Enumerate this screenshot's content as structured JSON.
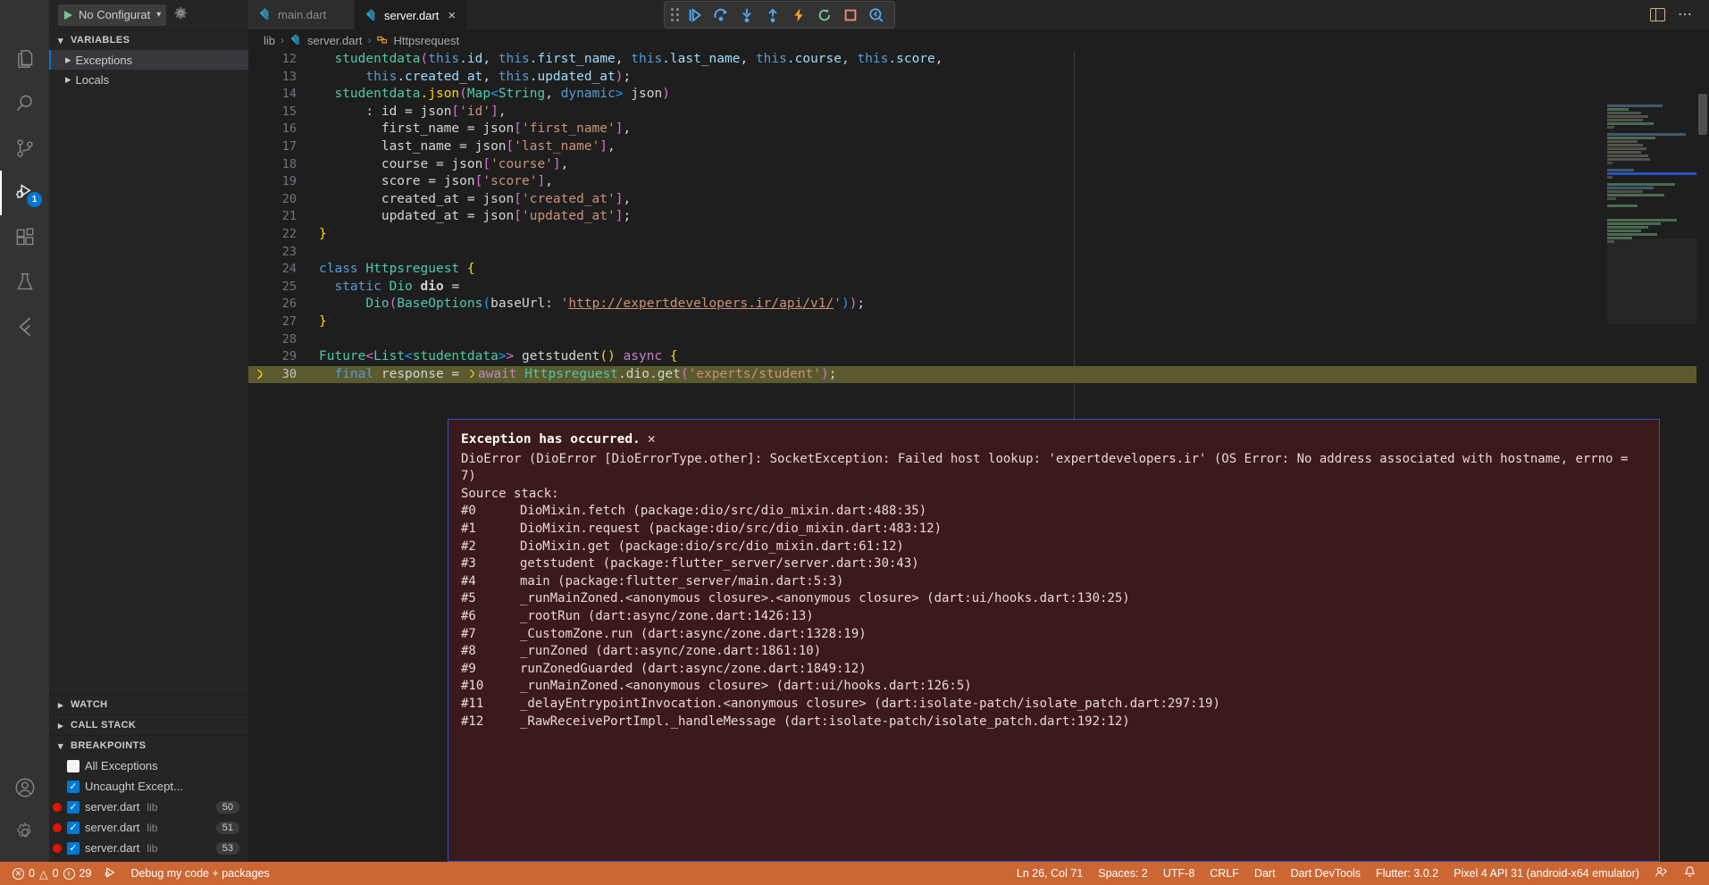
{
  "titlebar": {
    "run_config_label": "No Configurat",
    "run_config_full": "No Configurations",
    "gear_icon": "gear-icon",
    "play_icon": "play-icon",
    "chevron_icon": "chevron-down-icon",
    "layout_icon": "toggle-panel-icon",
    "more_icon": "more-actions-icon"
  },
  "tabs": [
    {
      "label": "main.dart",
      "active": false,
      "icon": "dart-file-icon"
    },
    {
      "label": "server.dart",
      "active": true,
      "icon": "dart-file-icon"
    }
  ],
  "debug_toolbar": {
    "buttons": [
      {
        "name": "drag-handle",
        "title": "Drag"
      },
      {
        "name": "continue-button",
        "title": "Continue"
      },
      {
        "name": "step-over-button",
        "title": "Step Over"
      },
      {
        "name": "step-into-button",
        "title": "Step Into"
      },
      {
        "name": "step-out-button",
        "title": "Step Out"
      },
      {
        "name": "hot-reload-button",
        "title": "Hot Reload"
      },
      {
        "name": "restart-button",
        "title": "Hot Restart"
      },
      {
        "name": "stop-button",
        "title": "Stop"
      },
      {
        "name": "inspect-widget-button",
        "title": "Inspect Widget"
      }
    ]
  },
  "activitybar": {
    "items": [
      {
        "name": "explorer",
        "icon": "files-icon",
        "active": false
      },
      {
        "name": "search",
        "icon": "search-icon",
        "active": false
      },
      {
        "name": "source-control",
        "icon": "source-control-icon",
        "active": false
      },
      {
        "name": "run-and-debug",
        "icon": "debug-icon",
        "active": true,
        "badge": "1"
      },
      {
        "name": "extensions",
        "icon": "extensions-icon",
        "active": false
      },
      {
        "name": "testing",
        "icon": "beaker-icon",
        "active": false
      },
      {
        "name": "flutter",
        "icon": "flutter-icon",
        "active": false
      }
    ],
    "bottom": [
      {
        "name": "accounts",
        "icon": "account-icon"
      },
      {
        "name": "settings",
        "icon": "gear-icon"
      }
    ]
  },
  "sidebar": {
    "variables": {
      "title": "VARIABLES",
      "expanded": true,
      "rows": [
        {
          "label": "Exceptions",
          "selected": true
        },
        {
          "label": "Locals",
          "selected": false
        }
      ]
    },
    "watch": {
      "title": "WATCH",
      "expanded": false
    },
    "callstack": {
      "title": "CALL STACK",
      "expanded": false
    },
    "breakpoints": {
      "title": "BREAKPOINTS",
      "expanded": true,
      "rows": [
        {
          "label": "All Exceptions",
          "checked": false,
          "dot": false,
          "lib": "",
          "line": ""
        },
        {
          "label": "Uncaught Except...",
          "checked": true,
          "dot": false,
          "lib": "",
          "line": ""
        },
        {
          "label": "server.dart",
          "checked": true,
          "dot": true,
          "lib": "lib",
          "line": "50"
        },
        {
          "label": "server.dart",
          "checked": true,
          "dot": true,
          "lib": "lib",
          "line": "51"
        },
        {
          "label": "server.dart",
          "checked": true,
          "dot": true,
          "lib": "lib",
          "line": "53"
        }
      ]
    }
  },
  "breadcrumb": {
    "items": [
      "lib",
      "server.dart",
      "Httpsrequest"
    ],
    "separator": "›"
  },
  "editor": {
    "lines": [
      {
        "num": "12",
        "marker": false,
        "highlight": false,
        "tokens": [
          {
            "t": "  ",
            "c": "t-plain"
          },
          {
            "t": "studentdata",
            "c": "t-fn"
          },
          {
            "t": "(",
            "c": "t-p2"
          },
          {
            "t": "this",
            "c": "t-this"
          },
          {
            "t": ".id",
            "c": "t-var"
          },
          {
            "t": ", ",
            "c": "t-plain"
          },
          {
            "t": "this",
            "c": "t-this"
          },
          {
            "t": ".first_name",
            "c": "t-var"
          },
          {
            "t": ", ",
            "c": "t-plain"
          },
          {
            "t": "this",
            "c": "t-this"
          },
          {
            "t": ".last_name",
            "c": "t-var"
          },
          {
            "t": ", ",
            "c": "t-plain"
          },
          {
            "t": "this",
            "c": "t-this"
          },
          {
            "t": ".course",
            "c": "t-var"
          },
          {
            "t": ", ",
            "c": "t-plain"
          },
          {
            "t": "this",
            "c": "t-this"
          },
          {
            "t": ".score",
            "c": "t-var"
          },
          {
            "t": ",",
            "c": "t-plain"
          }
        ]
      },
      {
        "num": "13",
        "marker": false,
        "highlight": false,
        "tokens": [
          {
            "t": "      ",
            "c": "t-plain"
          },
          {
            "t": "this",
            "c": "t-this"
          },
          {
            "t": ".created_at",
            "c": "t-var"
          },
          {
            "t": ", ",
            "c": "t-plain"
          },
          {
            "t": "this",
            "c": "t-this"
          },
          {
            "t": ".updated_at",
            "c": "t-var"
          },
          {
            "t": ")",
            "c": "t-p2"
          },
          {
            "t": ";",
            "c": "t-plain"
          }
        ]
      },
      {
        "num": "14",
        "marker": false,
        "highlight": false,
        "tokens": [
          {
            "t": "  ",
            "c": "t-plain"
          },
          {
            "t": "studentdata",
            "c": "t-fn"
          },
          {
            "t": ".json",
            "c": "t-p1"
          },
          {
            "t": "(",
            "c": "t-p2"
          },
          {
            "t": "Map",
            "c": "t-cls"
          },
          {
            "t": "<",
            "c": "t-p3"
          },
          {
            "t": "String",
            "c": "t-cls"
          },
          {
            "t": ", ",
            "c": "t-plain"
          },
          {
            "t": "dynamic",
            "c": "t-kw"
          },
          {
            "t": ">",
            "c": "t-p3"
          },
          {
            "t": " json",
            "c": "t-plain"
          },
          {
            "t": ")",
            "c": "t-p2"
          }
        ]
      },
      {
        "num": "15",
        "marker": false,
        "highlight": false,
        "tokens": [
          {
            "t": "      : id = ",
            "c": "t-plain"
          },
          {
            "t": "json",
            "c": "t-plain"
          },
          {
            "t": "[",
            "c": "t-p2"
          },
          {
            "t": "'id'",
            "c": "t-str"
          },
          {
            "t": "]",
            "c": "t-p2"
          },
          {
            "t": ",",
            "c": "t-plain"
          }
        ]
      },
      {
        "num": "16",
        "marker": false,
        "highlight": false,
        "tokens": [
          {
            "t": "        first_name = ",
            "c": "t-plain"
          },
          {
            "t": "json",
            "c": "t-plain"
          },
          {
            "t": "[",
            "c": "t-p2"
          },
          {
            "t": "'first_name'",
            "c": "t-str"
          },
          {
            "t": "]",
            "c": "t-p2"
          },
          {
            "t": ",",
            "c": "t-plain"
          }
        ]
      },
      {
        "num": "17",
        "marker": false,
        "highlight": false,
        "tokens": [
          {
            "t": "        last_name = ",
            "c": "t-plain"
          },
          {
            "t": "json",
            "c": "t-plain"
          },
          {
            "t": "[",
            "c": "t-p2"
          },
          {
            "t": "'last_name'",
            "c": "t-str"
          },
          {
            "t": "]",
            "c": "t-p2"
          },
          {
            "t": ",",
            "c": "t-plain"
          }
        ]
      },
      {
        "num": "18",
        "marker": false,
        "highlight": false,
        "tokens": [
          {
            "t": "        course = ",
            "c": "t-plain"
          },
          {
            "t": "json",
            "c": "t-plain"
          },
          {
            "t": "[",
            "c": "t-p2"
          },
          {
            "t": "'course'",
            "c": "t-str"
          },
          {
            "t": "]",
            "c": "t-p2"
          },
          {
            "t": ",",
            "c": "t-plain"
          }
        ]
      },
      {
        "num": "19",
        "marker": false,
        "highlight": false,
        "tokens": [
          {
            "t": "        score = ",
            "c": "t-plain"
          },
          {
            "t": "json",
            "c": "t-plain"
          },
          {
            "t": "[",
            "c": "t-p2"
          },
          {
            "t": "'score'",
            "c": "t-str"
          },
          {
            "t": "]",
            "c": "t-p2"
          },
          {
            "t": ",",
            "c": "t-plain"
          }
        ]
      },
      {
        "num": "20",
        "marker": false,
        "highlight": false,
        "tokens": [
          {
            "t": "        created_at = ",
            "c": "t-plain"
          },
          {
            "t": "json",
            "c": "t-plain"
          },
          {
            "t": "[",
            "c": "t-p2"
          },
          {
            "t": "'created_at'",
            "c": "t-str"
          },
          {
            "t": "]",
            "c": "t-p2"
          },
          {
            "t": ",",
            "c": "t-plain"
          }
        ]
      },
      {
        "num": "21",
        "marker": false,
        "highlight": false,
        "tokens": [
          {
            "t": "        updated_at = ",
            "c": "t-plain"
          },
          {
            "t": "json",
            "c": "t-plain"
          },
          {
            "t": "[",
            "c": "t-p2"
          },
          {
            "t": "'updated_at'",
            "c": "t-str"
          },
          {
            "t": "]",
            "c": "t-p2"
          },
          {
            "t": ";",
            "c": "t-plain"
          }
        ]
      },
      {
        "num": "22",
        "marker": false,
        "highlight": false,
        "tokens": [
          {
            "t": "}",
            "c": "t-p1"
          }
        ]
      },
      {
        "num": "23",
        "marker": false,
        "highlight": false,
        "tokens": []
      },
      {
        "num": "24",
        "marker": false,
        "highlight": false,
        "tokens": [
          {
            "t": "class",
            "c": "t-kw"
          },
          {
            "t": " ",
            "c": "t-plain"
          },
          {
            "t": "Httpsreguest",
            "c": "t-cls"
          },
          {
            "t": " ",
            "c": "t-plain"
          },
          {
            "t": "{",
            "c": "t-p1"
          }
        ]
      },
      {
        "num": "25",
        "marker": false,
        "highlight": false,
        "tokens": [
          {
            "t": "  ",
            "c": "t-plain"
          },
          {
            "t": "static",
            "c": "t-kw"
          },
          {
            "t": " ",
            "c": "t-plain"
          },
          {
            "t": "Dio",
            "c": "t-cls"
          },
          {
            "t": " ",
            "c": "t-plain"
          },
          {
            "t": "dio",
            "c": "t-plain t-bold"
          },
          {
            "t": " =",
            "c": "t-plain"
          }
        ]
      },
      {
        "num": "26",
        "marker": false,
        "highlight": false,
        "tokens": [
          {
            "t": "      ",
            "c": "t-plain"
          },
          {
            "t": "Dio",
            "c": "t-cls"
          },
          {
            "t": "(",
            "c": "t-p2"
          },
          {
            "t": "BaseOptions",
            "c": "t-cls"
          },
          {
            "t": "(",
            "c": "t-p3"
          },
          {
            "t": "baseUrl",
            "c": "t-plain"
          },
          {
            "t": ": ",
            "c": "t-plain"
          },
          {
            "t": "'",
            "c": "t-str"
          },
          {
            "t": "http://expertdevelopers.ir/api/v1/",
            "c": "t-link"
          },
          {
            "t": "'",
            "c": "t-str"
          },
          {
            "t": ")",
            "c": "t-p3"
          },
          {
            "t": ")",
            "c": "t-p2"
          },
          {
            "t": ";",
            "c": "t-plain"
          }
        ]
      },
      {
        "num": "27",
        "marker": false,
        "highlight": false,
        "tokens": [
          {
            "t": "}",
            "c": "t-p1"
          }
        ]
      },
      {
        "num": "28",
        "marker": false,
        "highlight": false,
        "tokens": []
      },
      {
        "num": "29",
        "marker": false,
        "highlight": false,
        "tokens": [
          {
            "t": "Future",
            "c": "t-cls"
          },
          {
            "t": "<",
            "c": "t-p2"
          },
          {
            "t": "List",
            "c": "t-cls"
          },
          {
            "t": "<",
            "c": "t-p3"
          },
          {
            "t": "studentdata",
            "c": "t-fn"
          },
          {
            "t": ">",
            "c": "t-p3"
          },
          {
            "t": ">",
            "c": "t-p2"
          },
          {
            "t": " getstudent",
            "c": "t-plain"
          },
          {
            "t": "(",
            "c": "t-p1"
          },
          {
            "t": ")",
            "c": "t-p1"
          },
          {
            "t": " ",
            "c": "t-plain"
          },
          {
            "t": "async",
            "c": "t-kw2"
          },
          {
            "t": " ",
            "c": "t-plain"
          },
          {
            "t": "{",
            "c": "t-p1"
          }
        ]
      },
      {
        "num": "30",
        "marker": true,
        "highlight": true,
        "tokens": [
          {
            "t": "  ",
            "c": "t-plain"
          },
          {
            "t": "final",
            "c": "t-kw"
          },
          {
            "t": " response = ",
            "c": "t-plain"
          },
          {
            "t": "await",
            "c": "t-kw2"
          },
          {
            "t": " ",
            "c": "t-plain"
          },
          {
            "t": "Httpsreguest",
            "c": "t-fn"
          },
          {
            "t": ".dio",
            "c": "t-plain"
          },
          {
            "t": ".get",
            "c": "t-plain"
          },
          {
            "t": "(",
            "c": "t-p2"
          },
          {
            "t": "'experts/student'",
            "c": "t-str"
          },
          {
            "t": ")",
            "c": "t-p2"
          },
          {
            "t": ";",
            "c": "t-plain"
          }
        ]
      }
    ]
  },
  "exception": {
    "title": "Exception has occurred.",
    "close_icon": "close-icon",
    "message": "DioError (DioError [DioErrorType.other]: SocketException: Failed host lookup: 'expertdevelopers.ir' (OS Error: No address associated with hostname, errno = 7)",
    "stack_header": "Source stack:",
    "stack": [
      {
        "idx": "#0",
        "frame": "DioMixin.fetch (package:dio/src/dio_mixin.dart:488:35)"
      },
      {
        "idx": "#1",
        "frame": "DioMixin.request (package:dio/src/dio_mixin.dart:483:12)"
      },
      {
        "idx": "#2",
        "frame": "DioMixin.get (package:dio/src/dio_mixin.dart:61:12)"
      },
      {
        "idx": "#3",
        "frame": "getstudent (package:flutter_server/server.dart:30:43)"
      },
      {
        "idx": "#4",
        "frame": "main (package:flutter_server/main.dart:5:3)"
      },
      {
        "idx": "#5",
        "frame": "_runMainZoned.<anonymous closure>.<anonymous closure> (dart:ui/hooks.dart:130:25)"
      },
      {
        "idx": "#6",
        "frame": "_rootRun (dart:async/zone.dart:1426:13)"
      },
      {
        "idx": "#7",
        "frame": "_CustomZone.run (dart:async/zone.dart:1328:19)"
      },
      {
        "idx": "#8",
        "frame": "_runZoned (dart:async/zone.dart:1861:10)"
      },
      {
        "idx": "#9",
        "frame": "runZonedGuarded (dart:async/zone.dart:1849:12)"
      },
      {
        "idx": "#10",
        "frame": "_runMainZoned.<anonymous closure> (dart:ui/hooks.dart:126:5)"
      },
      {
        "idx": "#11",
        "frame": "_delayEntrypointInvocation.<anonymous closure> (dart:isolate-patch/isolate_patch.dart:297:19)"
      },
      {
        "idx": "#12",
        "frame": "_RawReceivePortImpl._handleMessage (dart:isolate-patch/isolate_patch.dart:192:12)"
      }
    ]
  },
  "statusbar": {
    "errors": "0",
    "warnings": "0",
    "infos": "29",
    "debug_mode": "Debug my code + packages",
    "line_col": "Ln 26, Col 71",
    "spaces": "Spaces: 2",
    "encoding": "UTF-8",
    "eol": "CRLF",
    "language": "Dart",
    "devtools": "Dart DevTools",
    "flutter_version": "Flutter: 3.0.2",
    "device": "Pixel 4 API 31 (android-x64 emulator)",
    "remote_icon": "remote-icon",
    "bell_icon": "bell-icon",
    "background": "#cc6633"
  }
}
